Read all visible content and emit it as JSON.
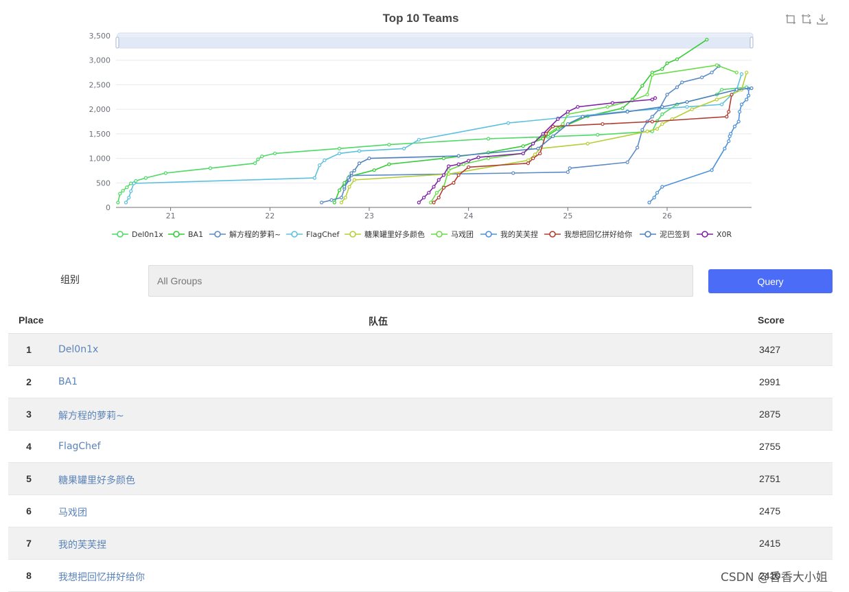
{
  "chart_data": {
    "type": "line",
    "title": "Top 10 Teams",
    "x_ticks": [
      "21",
      "22",
      "23",
      "24",
      "25",
      "26"
    ],
    "y_ticks": [
      "0",
      "500",
      "1,000",
      "1,500",
      "2,000",
      "2,500",
      "3,000",
      "3,500"
    ],
    "xlim": [
      20.45,
      26.85
    ],
    "ylim": [
      0,
      3500
    ],
    "legend_position": "bottom",
    "grid": true,
    "series": [
      {
        "name": "Del0n1x",
        "color": "#4cd964",
        "points": [
          [
            20.47,
            100
          ],
          [
            20.49,
            280
          ],
          [
            20.52,
            340
          ],
          [
            20.56,
            410
          ],
          [
            20.6,
            490
          ],
          [
            20.65,
            540
          ],
          [
            20.75,
            600
          ],
          [
            20.95,
            700
          ],
          [
            21.4,
            800
          ],
          [
            21.85,
            900
          ],
          [
            21.88,
            980
          ],
          [
            21.92,
            1040
          ],
          [
            22.05,
            1100
          ],
          [
            22.7,
            1200
          ],
          [
            23.2,
            1280
          ],
          [
            24.2,
            1400
          ],
          [
            24.8,
            1440
          ],
          [
            25.3,
            1480
          ],
          [
            25.85,
            1550
          ],
          [
            25.9,
            1760
          ],
          [
            25.95,
            1900
          ],
          [
            26.1,
            2100
          ],
          [
            26.5,
            2300
          ],
          [
            26.55,
            2400
          ],
          [
            26.8,
            2450
          ]
        ]
      },
      {
        "name": "BA1",
        "color": "#33cc33",
        "points": [
          [
            22.65,
            100
          ],
          [
            22.7,
            350
          ],
          [
            22.75,
            500
          ],
          [
            22.8,
            630
          ],
          [
            23.05,
            760
          ],
          [
            23.2,
            880
          ],
          [
            23.75,
            1000
          ],
          [
            24.2,
            1120
          ],
          [
            24.55,
            1250
          ],
          [
            24.75,
            1400
          ],
          [
            24.9,
            1600
          ],
          [
            25.2,
            1860
          ],
          [
            25.55,
            2020
          ],
          [
            25.65,
            2200
          ],
          [
            25.75,
            2480
          ],
          [
            25.85,
            2750
          ],
          [
            25.95,
            2820
          ],
          [
            26.0,
            2940
          ],
          [
            26.1,
            3020
          ],
          [
            26.4,
            3420
          ]
        ]
      },
      {
        "name": "解方程的萝莉~",
        "color": "#5b8ac4",
        "points": [
          [
            22.52,
            100
          ],
          [
            22.62,
            150
          ],
          [
            22.72,
            200
          ],
          [
            22.75,
            380
          ],
          [
            22.79,
            600
          ],
          [
            22.82,
            650
          ],
          [
            24.45,
            700
          ],
          [
            25.0,
            720
          ],
          [
            25.02,
            800
          ],
          [
            25.6,
            920
          ],
          [
            25.7,
            1220
          ],
          [
            25.75,
            1580
          ],
          [
            25.8,
            1750
          ],
          [
            25.85,
            1850
          ],
          [
            25.92,
            2000
          ],
          [
            26.0,
            2300
          ],
          [
            26.1,
            2450
          ],
          [
            26.15,
            2550
          ],
          [
            26.35,
            2650
          ],
          [
            26.45,
            2750
          ],
          [
            26.52,
            2880
          ]
        ]
      },
      {
        "name": "FlagChef",
        "color": "#5bc0de",
        "points": [
          [
            20.55,
            100
          ],
          [
            20.58,
            200
          ],
          [
            20.6,
            330
          ],
          [
            20.63,
            490
          ],
          [
            22.45,
            600
          ],
          [
            22.5,
            860
          ],
          [
            22.55,
            960
          ],
          [
            22.7,
            1100
          ],
          [
            22.9,
            1150
          ],
          [
            23.35,
            1200
          ],
          [
            23.5,
            1380
          ],
          [
            24.4,
            1720
          ],
          [
            24.9,
            1820
          ],
          [
            25.6,
            1960
          ],
          [
            26.2,
            2050
          ],
          [
            26.55,
            2100
          ],
          [
            26.7,
            2400
          ],
          [
            26.75,
            2720
          ]
        ]
      },
      {
        "name": "糖果罐里好多颜色",
        "color": "#b5cf32",
        "points": [
          [
            22.72,
            100
          ],
          [
            22.76,
            200
          ],
          [
            22.8,
            420
          ],
          [
            22.85,
            560
          ],
          [
            23.8,
            680
          ],
          [
            24.6,
            960
          ],
          [
            24.67,
            1080
          ],
          [
            24.72,
            1200
          ],
          [
            25.2,
            1300
          ],
          [
            25.8,
            1550
          ],
          [
            25.9,
            1600
          ],
          [
            25.95,
            1700
          ],
          [
            26.05,
            1800
          ],
          [
            26.25,
            2000
          ],
          [
            26.5,
            2200
          ],
          [
            26.65,
            2300
          ],
          [
            26.75,
            2400
          ],
          [
            26.8,
            2750
          ]
        ]
      },
      {
        "name": "马戏团",
        "color": "#66dd44",
        "points": [
          [
            23.62,
            100
          ],
          [
            23.68,
            300
          ],
          [
            23.75,
            420
          ],
          [
            23.8,
            760
          ],
          [
            23.95,
            880
          ],
          [
            24.2,
            1000
          ],
          [
            24.55,
            1100
          ],
          [
            24.62,
            1220
          ],
          [
            24.7,
            1400
          ],
          [
            24.8,
            1500
          ],
          [
            24.95,
            1700
          ],
          [
            25.0,
            1900
          ],
          [
            25.4,
            2050
          ],
          [
            25.65,
            2180
          ],
          [
            25.8,
            2300
          ],
          [
            25.85,
            2700
          ],
          [
            26.5,
            2900
          ],
          [
            26.7,
            2750
          ]
        ]
      },
      {
        "name": "我的芙芙捏",
        "color": "#4a90d9",
        "points": [
          [
            25.82,
            100
          ],
          [
            25.87,
            200
          ],
          [
            25.9,
            300
          ],
          [
            25.95,
            420
          ],
          [
            26.45,
            760
          ],
          [
            26.58,
            1200
          ],
          [
            26.62,
            1350
          ],
          [
            26.63,
            1450
          ],
          [
            26.64,
            1500
          ],
          [
            26.68,
            1650
          ],
          [
            26.72,
            1750
          ],
          [
            26.73,
            1950
          ],
          [
            26.75,
            2100
          ],
          [
            26.8,
            2200
          ],
          [
            26.82,
            2280
          ],
          [
            26.82,
            2420
          ]
        ]
      },
      {
        "name": "我想把回忆拼好给你",
        "color": "#b03a2e",
        "points": [
          [
            23.65,
            100
          ],
          [
            23.7,
            200
          ],
          [
            23.75,
            400
          ],
          [
            23.85,
            500
          ],
          [
            23.9,
            660
          ],
          [
            24.0,
            820
          ],
          [
            24.6,
            900
          ],
          [
            24.65,
            1000
          ],
          [
            24.72,
            1100
          ],
          [
            24.78,
            1500
          ],
          [
            24.85,
            1650
          ],
          [
            25.35,
            1700
          ],
          [
            25.85,
            1750
          ],
          [
            26.6,
            1850
          ],
          [
            26.62,
            1950
          ],
          [
            26.65,
            2300
          ]
        ]
      },
      {
        "name": "泥巴签到",
        "color": "#4d7fbf",
        "points": [
          [
            22.75,
            420
          ],
          [
            22.8,
            560
          ],
          [
            22.82,
            700
          ],
          [
            22.85,
            750
          ],
          [
            22.9,
            900
          ],
          [
            23.0,
            1000
          ],
          [
            23.9,
            1050
          ],
          [
            24.7,
            1200
          ],
          [
            24.85,
            1450
          ],
          [
            25.0,
            1700
          ],
          [
            25.15,
            1850
          ],
          [
            25.6,
            1950
          ],
          [
            25.95,
            2050
          ],
          [
            26.2,
            2150
          ],
          [
            26.7,
            2400
          ],
          [
            26.85,
            2430
          ]
        ]
      },
      {
        "name": "X0R",
        "color": "#7f1fa6",
        "points": [
          [
            23.5,
            100
          ],
          [
            23.55,
            200
          ],
          [
            23.6,
            300
          ],
          [
            23.65,
            420
          ],
          [
            23.7,
            560
          ],
          [
            23.75,
            660
          ],
          [
            23.8,
            840
          ],
          [
            23.9,
            880
          ],
          [
            24.0,
            950
          ],
          [
            24.1,
            1020
          ],
          [
            24.55,
            1100
          ],
          [
            24.65,
            1300
          ],
          [
            24.75,
            1500
          ],
          [
            24.9,
            1800
          ],
          [
            25.0,
            1950
          ],
          [
            25.1,
            2050
          ],
          [
            25.45,
            2130
          ],
          [
            25.85,
            2200
          ],
          [
            25.88,
            2230
          ]
        ]
      }
    ]
  },
  "filter": {
    "label": "组别",
    "placeholder": "All Groups",
    "button": "Query"
  },
  "table": {
    "headers": {
      "place": "Place",
      "team": "队伍",
      "score": "Score"
    },
    "rows": [
      {
        "place": "1",
        "team": "Del0n1x",
        "score": "3427"
      },
      {
        "place": "2",
        "team": "BA1",
        "score": "2991"
      },
      {
        "place": "3",
        "team": "解方程的萝莉~",
        "score": "2875"
      },
      {
        "place": "4",
        "team": "FlagChef",
        "score": "2755"
      },
      {
        "place": "5",
        "team": "糖果罐里好多颜色",
        "score": "2751"
      },
      {
        "place": "6",
        "team": "马戏团",
        "score": "2475"
      },
      {
        "place": "7",
        "team": "我的芙芙捏",
        "score": "2415"
      },
      {
        "place": "8",
        "team": "我想把回忆拼好给你",
        "score": "2410"
      }
    ]
  },
  "toolbox": {
    "icons": [
      "zoom-icon",
      "zoom-reset-icon",
      "download-icon"
    ]
  },
  "watermark": "CSDN @香香大小姐"
}
